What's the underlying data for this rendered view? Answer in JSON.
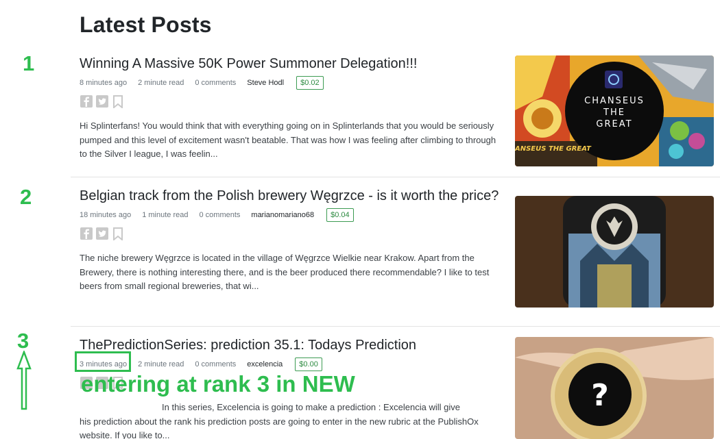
{
  "page_title": "Latest Posts",
  "ranks": [
    "1",
    "2",
    "3"
  ],
  "posts": [
    {
      "title": "Winning A Massive 50K Power Summoner Delegation!!!",
      "time": "8 minutes ago",
      "read": "2 minute read",
      "comments": "0 comments",
      "author": "Steve Hodl",
      "price": "$0.02",
      "excerpt": "Hi Splinterfans! You would think that with everything going on in Splinterlands that you would be seriously pumped and this level of excitement wasn't beatable. That was how I was feeling after climbing to through to the Silver I league, I was feelin...",
      "thumbnail": {
        "text_line1": "CHANSEUS",
        "text_line2": "THE",
        "text_line3": "GREAT",
        "banner": "ANSEUS THE GREAT"
      }
    },
    {
      "title": "Belgian track from the Polish brewery Węgrzce - is it worth the price?",
      "time": "18 minutes ago",
      "read": "1 minute read",
      "comments": "0 comments",
      "author": "marianomariano68",
      "price": "$0.04",
      "excerpt": "The niche brewery Węgrzce is located in the village of Węgrzce Wielkie near Krakow. Apart from the Brewery, there is nothing interesting there, and is the beer produced there recommendable? I like to test beers from small regional breweries, that wi..."
    },
    {
      "title": "ThePredictionSeries: prediction 35.1: Todays Prediction",
      "time": "3 minutes ago",
      "read": "2 minute read",
      "comments": "0 comments",
      "author": "excelencia",
      "price": "$0.00",
      "excerpt_line1": "In this  series, Excelencia is going  to make a  prediction :      Excelencia will give",
      "excerpt_rest": "his prediction about the rank his  prediction posts are going to enter in the new rubric at the PublishOx website. If you like to..."
    }
  ],
  "annotation": {
    "overlay_text": "entering at rank 3 in NEW"
  },
  "colors": {
    "annotation_green": "#2ebd4f",
    "price_border": "#3c9b52"
  },
  "icons": [
    "facebook-icon",
    "twitter-icon",
    "bookmark-icon",
    "up-arrow-icon"
  ]
}
